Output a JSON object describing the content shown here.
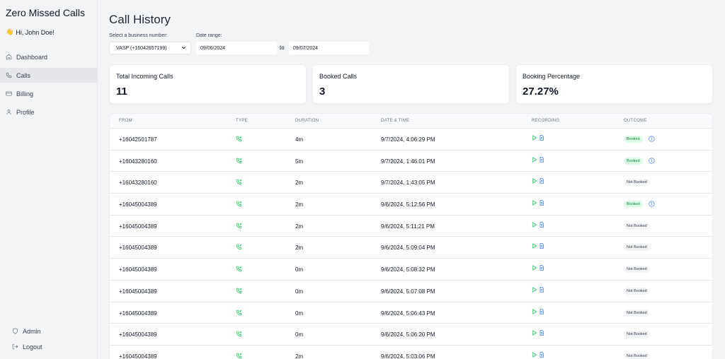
{
  "app": {
    "brand": "Zero Missed Calls",
    "greeting_emoji": "👋",
    "greeting": "Hi, John Doe!"
  },
  "sidebar": {
    "items": [
      {
        "label": "Dashboard",
        "icon": "home-icon",
        "active": false
      },
      {
        "label": "Calls",
        "icon": "phone-icon",
        "active": true
      },
      {
        "label": "Billing",
        "icon": "credit-card-icon",
        "active": false
      },
      {
        "label": "Profile",
        "icon": "user-icon",
        "active": false
      }
    ],
    "bottom_items": [
      {
        "label": "Admin",
        "icon": "shield-icon"
      },
      {
        "label": "Logout",
        "icon": "logout-icon"
      }
    ]
  },
  "page": {
    "title": "Call History"
  },
  "filters": {
    "business_label": "Select a business number:",
    "business_value": "VASP (+16042657199)",
    "date_label": "Date range:",
    "date_from": "09/06/2024",
    "to": "to",
    "date_to": "09/07/2024"
  },
  "stats": [
    {
      "label": "Total Incoming Calls",
      "value": "11"
    },
    {
      "label": "Booked Calls",
      "value": "3"
    },
    {
      "label": "Booking Percentage",
      "value": "27.27%"
    }
  ],
  "table": {
    "columns": [
      "From",
      "Type",
      "Duration",
      "Date & Time",
      "Recording",
      "Outcome"
    ],
    "rows": [
      {
        "from": "+16042501787",
        "duration": "4m",
        "datetime": "9/7/2024, 4:06:29 PM",
        "outcome": "Booked",
        "info": true
      },
      {
        "from": "+16043280160",
        "duration": "5m",
        "datetime": "9/7/2024, 1:46:01 PM",
        "outcome": "Booked",
        "info": true
      },
      {
        "from": "+16043280160",
        "duration": "2m",
        "datetime": "9/7/2024, 1:43:05 PM",
        "outcome": "Not Booked",
        "info": false
      },
      {
        "from": "+16045004389",
        "duration": "2m",
        "datetime": "9/6/2024, 5:12:56 PM",
        "outcome": "Booked",
        "info": true
      },
      {
        "from": "+16045004389",
        "duration": "2m",
        "datetime": "9/6/2024, 5:11:21 PM",
        "outcome": "Not Booked",
        "info": false
      },
      {
        "from": "+16045004389",
        "duration": "2m",
        "datetime": "9/6/2024, 5:09:04 PM",
        "outcome": "Not Booked",
        "info": false
      },
      {
        "from": "+16045004389",
        "duration": "0m",
        "datetime": "9/6/2024, 5:08:32 PM",
        "outcome": "Not Booked",
        "info": false
      },
      {
        "from": "+16045004389",
        "duration": "0m",
        "datetime": "9/6/2024, 5:07:08 PM",
        "outcome": "Not Booked",
        "info": false
      },
      {
        "from": "+16045004389",
        "duration": "0m",
        "datetime": "9/6/2024, 5:06:43 PM",
        "outcome": "Not Booked",
        "info": false
      },
      {
        "from": "+16045004389",
        "duration": "0m",
        "datetime": "9/6/2024, 5:06:20 PM",
        "outcome": "Not Booked",
        "info": false
      },
      {
        "from": "+16045004389",
        "duration": "2m",
        "datetime": "9/6/2024, 5:03:06 PM",
        "outcome": "Not Booked",
        "info": false
      }
    ]
  },
  "colors": {
    "booked_bg": "#dcfce7",
    "booked_text": "#15803d",
    "icon_green": "#22c55e",
    "recording_blue": "#3b82f6",
    "info_blue": "#3b82f6"
  }
}
